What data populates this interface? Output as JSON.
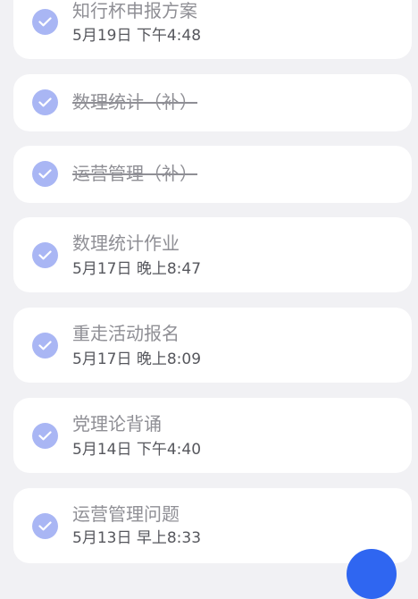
{
  "tasks": [
    {
      "title": "知行杯申报方案",
      "time": "5月19日 下午4:48",
      "status": "completed",
      "strikethrough": false
    },
    {
      "title": "数理统计（补）",
      "time": "",
      "status": "completed",
      "strikethrough": true
    },
    {
      "title": "运营管理（补）",
      "time": "",
      "status": "completed",
      "strikethrough": true
    },
    {
      "title": "数理统计作业",
      "time": "5月17日 晚上8:47",
      "status": "completed",
      "strikethrough": false
    },
    {
      "title": "重走活动报名",
      "time": "5月17日 晚上8:09",
      "status": "completed",
      "strikethrough": false
    },
    {
      "title": "党理论背诵",
      "time": "5月14日 下午4:40",
      "status": "completed",
      "strikethrough": false
    },
    {
      "title": "运营管理问题",
      "time": "5月13日 早上8:33",
      "status": "completed",
      "strikethrough": false
    }
  ],
  "icons": {
    "check": "check-icon",
    "fab": "add-icon"
  },
  "colors": {
    "background": "#f1f1f4",
    "card": "#ffffff",
    "check_circle": "#a9b6f4",
    "title_text": "#8f8f95",
    "time_text": "#56575d",
    "fab": "#2f66f1"
  }
}
